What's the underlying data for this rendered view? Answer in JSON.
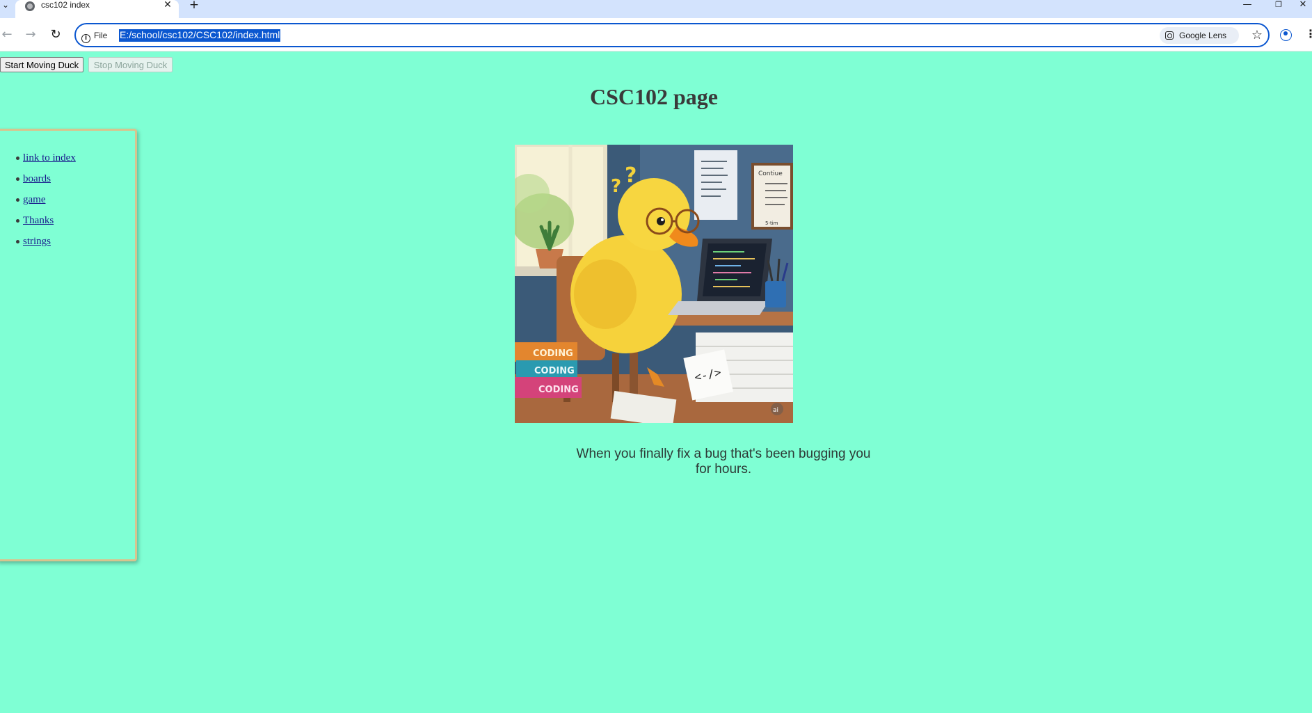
{
  "browser": {
    "tab_title": "csc102 index",
    "new_tab_icon": "+",
    "site_info_label": "File",
    "url": "E:/school/csc102/CSC102/index.html",
    "lens_label": "Google Lens"
  },
  "page": {
    "buttons": {
      "start": "Start Moving Duck",
      "stop": "Stop Moving Duck"
    },
    "title": "CSC102 page",
    "nav": [
      {
        "label": "link to index"
      },
      {
        "label": "boards"
      },
      {
        "label": "game"
      },
      {
        "label": "Thanks"
      },
      {
        "label": "strings"
      }
    ],
    "image": {
      "book_labels": [
        "CODING",
        "CODING",
        "CODING"
      ],
      "board_title": "Contiue",
      "board_footer": "5-tim",
      "paper_symbol": "<-/>",
      "watermark": "ai"
    },
    "caption": "When you finally fix a bug that's been bugging you for hours."
  },
  "colors": {
    "page_background": "#7fffd4",
    "omnibox_accent": "#0b57d0",
    "sidebar_border": "#d8c48e",
    "link": "#1a1a8c"
  }
}
